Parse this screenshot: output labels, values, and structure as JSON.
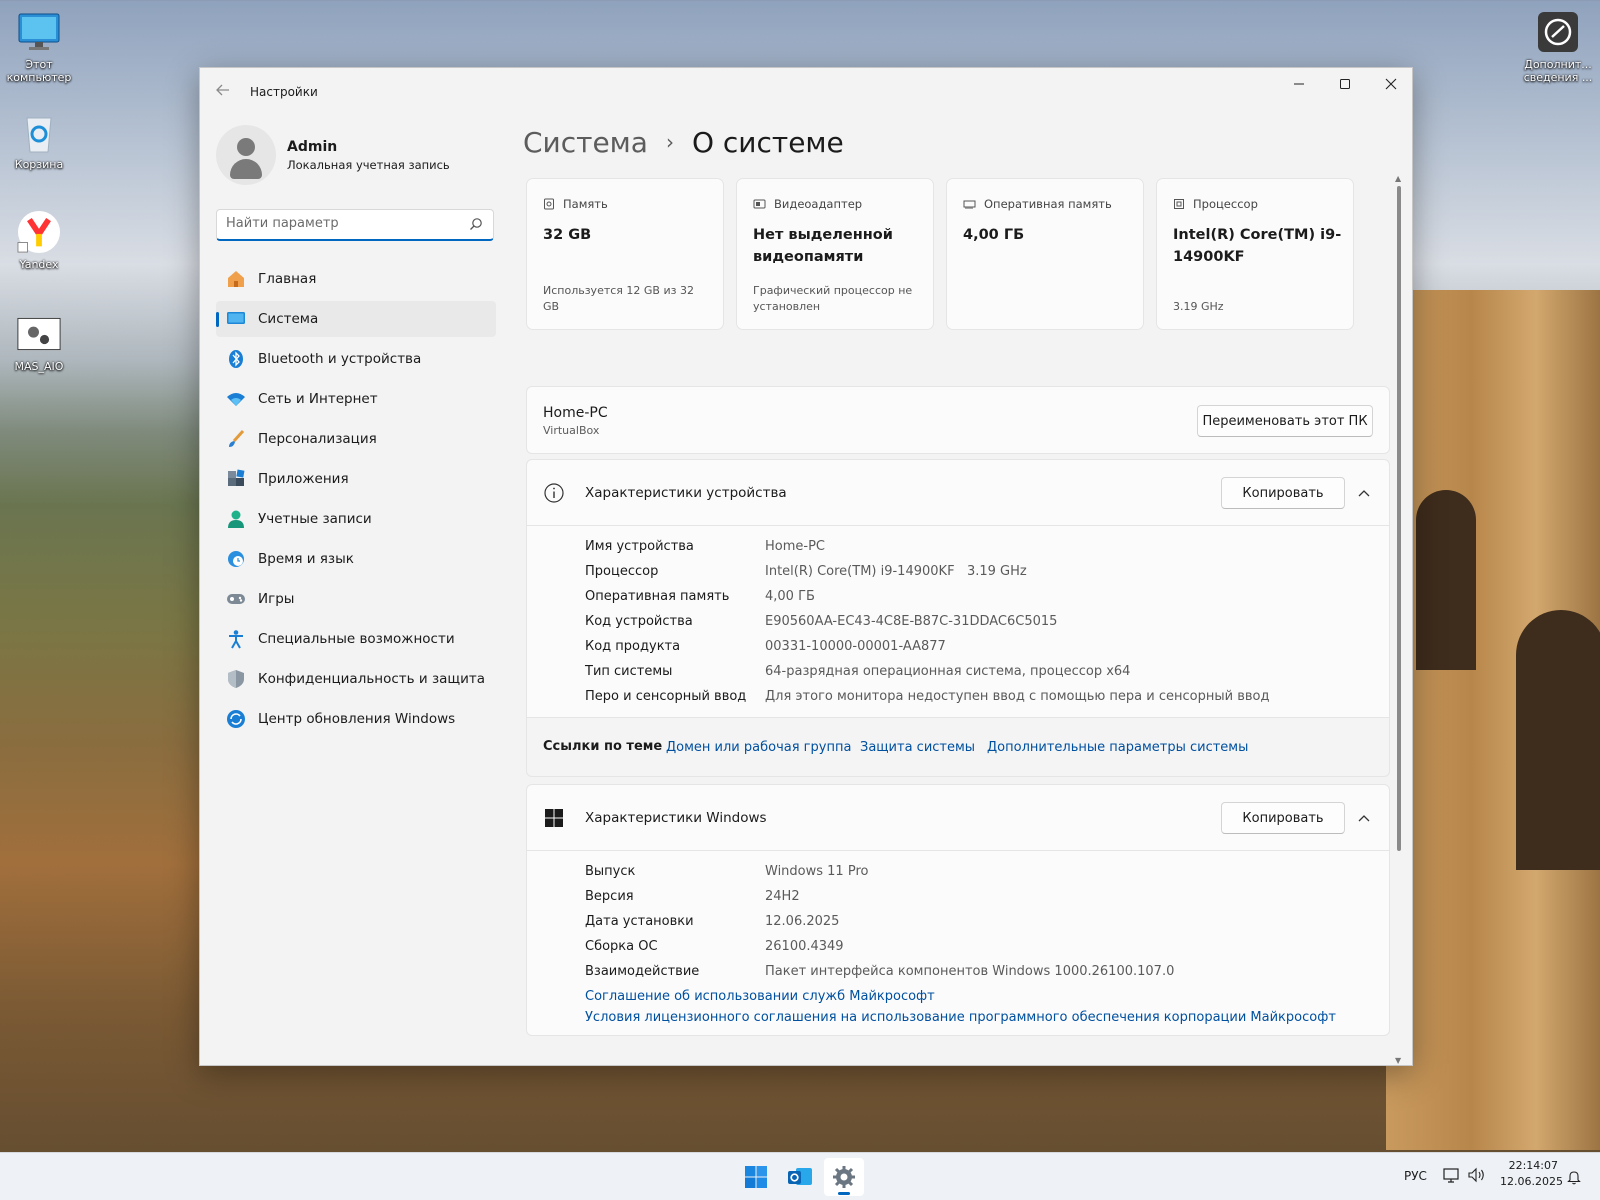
{
  "desktop": {
    "icons": [
      {
        "label": "Этот компьютер",
        "icon": "monitor-icon"
      },
      {
        "label": "Корзина",
        "icon": "recycle-bin-icon"
      },
      {
        "label": "Yandex",
        "icon": "yandex-browser-icon"
      },
      {
        "label": "MAS_AIO",
        "icon": "script-gear-icon"
      },
      {
        "label": "Дополнит... сведения ...",
        "icon": "info-circle-icon"
      }
    ]
  },
  "window": {
    "title": "Настройки",
    "buttons": {
      "minimize": "—",
      "maximize": "☐",
      "close": "✕"
    }
  },
  "user": {
    "name": "Admin",
    "subtitle": "Локальная учетная запись"
  },
  "search": {
    "placeholder": "Найти параметр"
  },
  "nav": [
    {
      "label": "Главная",
      "icon": "home-icon"
    },
    {
      "label": "Система",
      "icon": "system-icon",
      "active": true
    },
    {
      "label": "Bluetooth и устройства",
      "icon": "bluetooth-icon"
    },
    {
      "label": "Сеть и Интернет",
      "icon": "wifi-icon"
    },
    {
      "label": "Персонализация",
      "icon": "brush-icon"
    },
    {
      "label": "Приложения",
      "icon": "apps-icon"
    },
    {
      "label": "Учетные записи",
      "icon": "account-icon"
    },
    {
      "label": "Время и язык",
      "icon": "clock-globe-icon"
    },
    {
      "label": "Игры",
      "icon": "gamepad-icon"
    },
    {
      "label": "Специальные возможности",
      "icon": "accessibility-icon"
    },
    {
      "label": "Конфиденциальность и защита",
      "icon": "shield-icon"
    },
    {
      "label": "Центр обновления Windows",
      "icon": "update-icon"
    }
  ],
  "breadcrumb": {
    "parent": "Система",
    "separator": "›",
    "current": "О системе"
  },
  "cards": [
    {
      "title": "Память",
      "icon": "storage-icon",
      "value": "32 GB",
      "sub": "Используется 12 GB из 32 GB"
    },
    {
      "title": "Видеоадаптер",
      "icon": "gpu-icon",
      "value": "Нет выделенной видеопамяти",
      "sub": "Графический процессор не установлен"
    },
    {
      "title": "Оперативная память",
      "icon": "ram-icon",
      "value": "4,00 ГБ",
      "sub": ""
    },
    {
      "title": "Процессор",
      "icon": "cpu-icon",
      "value": "Intel(R) Core(TM) i9-14900KF",
      "sub": "3.19 GHz"
    }
  ],
  "pc": {
    "name": "Home-PC",
    "model": "VirtualBox",
    "rename_label": "Переименовать этот ПК"
  },
  "device_specs": {
    "title": "Характеристики устройства",
    "copy_label": "Копировать",
    "rows": [
      {
        "key": "Имя устройства",
        "value": "Home-PC"
      },
      {
        "key": "Процессор",
        "value": "Intel(R) Core(TM) i9-14900KF   3.19 GHz"
      },
      {
        "key": "Оперативная память",
        "value": "4,00 ГБ"
      },
      {
        "key": "Код устройства",
        "value": "E90560AA-EC43-4C8E-B87C-31DDAC6C5015"
      },
      {
        "key": "Код продукта",
        "value": "00331-10000-00001-AA877"
      },
      {
        "key": "Тип системы",
        "value": "64-разрядная операционная система, процессор x64"
      },
      {
        "key": "Перо и сенсорный ввод",
        "value": "Для этого монитора недоступен ввод с помощью пера и сенсорный ввод"
      }
    ]
  },
  "related_links": {
    "title": "Ссылки по теме",
    "links": [
      "Домен или рабочая группа",
      "Защита системы",
      "Дополнительные параметры системы"
    ]
  },
  "windows_specs": {
    "title": "Характеристики Windows",
    "copy_label": "Копировать",
    "rows": [
      {
        "key": "Выпуск",
        "value": "Windows 11 Pro"
      },
      {
        "key": "Версия",
        "value": "24H2"
      },
      {
        "key": "Дата установки",
        "value": "12.06.2025"
      },
      {
        "key": "Сборка ОС",
        "value": "26100.4349"
      },
      {
        "key": "Взаимодействие",
        "value": "Пакет интерфейса компонентов Windows 1000.26100.107.0"
      }
    ],
    "links": [
      "Соглашение об использовании служб Майкрософт",
      "Условия лицензионного соглашения на использование программного обеспечения корпорации Майкрософт"
    ]
  },
  "taskbar": {
    "apps": [
      "start-icon",
      "outlook-icon",
      "settings-icon"
    ],
    "language": "РУС",
    "time": "22:14:07",
    "date": "12.06.2025"
  },
  "colors": {
    "accent": "#0067c0",
    "link": "#0050a0",
    "window_bg": "#f3f3f3",
    "card_bg": "#fbfbfb"
  }
}
